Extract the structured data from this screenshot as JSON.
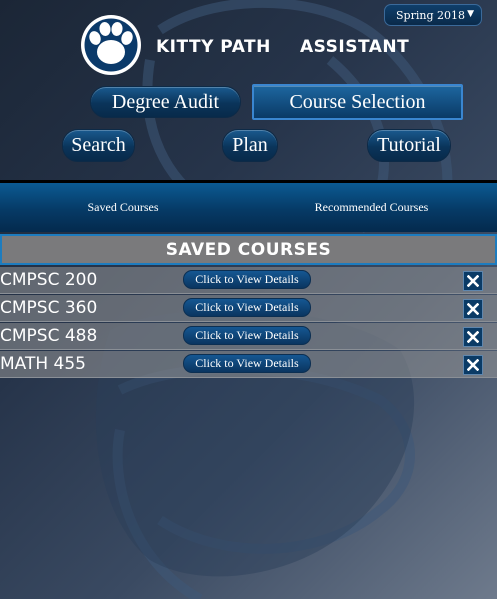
{
  "header": {
    "semester": {
      "selected": "Spring 2018",
      "caret": "▼"
    },
    "brand_left": "KITTY PATH",
    "brand_right": "ASSISTANT",
    "logo_icon": "paw-print-icon"
  },
  "nav": {
    "degree_audit": "Degree Audit",
    "course_selection": "Course Selection",
    "search": "Search",
    "plan": "Plan",
    "tutorial": "Tutorial",
    "active": "course_selection"
  },
  "tabs": {
    "saved": "Saved Courses",
    "recommended": "Recommended Courses"
  },
  "saved_section": {
    "title": "SAVED COURSES",
    "details_label": "Click to View Details",
    "remove_icon": "close-icon",
    "courses": [
      "CMPSC 200",
      "CMPSC 360",
      "CMPSC 488",
      "MATH 455"
    ]
  },
  "colors": {
    "accent": "#1d7cbf",
    "button": "#0a3a66",
    "header_bar": "#7a7a7c"
  }
}
